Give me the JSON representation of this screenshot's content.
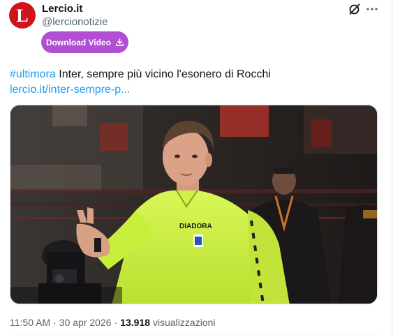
{
  "author": {
    "avatar_letter": "L",
    "display_name": "Lercio.it",
    "handle": "@lercionotizie"
  },
  "header_icons": [
    "grok-icon",
    "more-icon"
  ],
  "download_button": {
    "label": "Download Video"
  },
  "tweet": {
    "hashtag": "#ultimora",
    "text": " Inter, sempre più vicino l'esonero di Rocchi",
    "link": "lercio.it/inter-sempre-p..."
  },
  "media": {
    "jersey_text": "DIADORA"
  },
  "meta": {
    "time": "11:50 AM",
    "separator": "·",
    "date": "30 apr 2026",
    "separator2": "·",
    "views_count": "13.918",
    "views_label": "visualizzazioni"
  },
  "colors": {
    "brand_red": "#d0141b",
    "download_purple": "#b14fd2",
    "link_blue": "#1d9bf0",
    "secondary_text": "#536471",
    "jersey_green": "#c9ef3c"
  }
}
